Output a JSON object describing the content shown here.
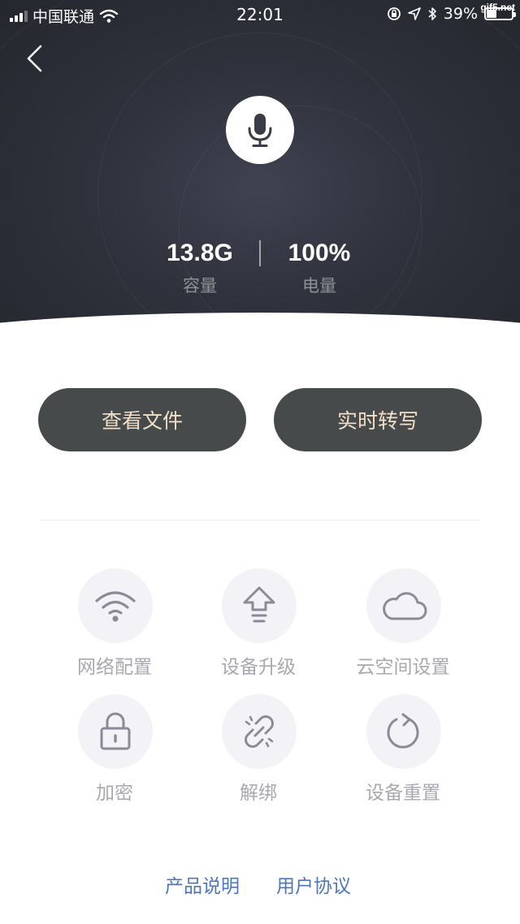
{
  "status_bar": {
    "carrier": "中国联通",
    "time": "22:01",
    "battery_percent": "39%",
    "battery_level": 0.39,
    "watermark": "gif5.net",
    "icons": [
      "signal-icon",
      "wifi-icon",
      "rotation-lock-icon",
      "location-icon",
      "bluetooth-icon",
      "battery-icon"
    ]
  },
  "header": {
    "back_icon": "chevron-left-icon",
    "device_icon": "microphone-icon",
    "capacity_value": "13.8G",
    "capacity_label": "容量",
    "battery_value": "100%",
    "battery_label": "电量"
  },
  "actions": {
    "view_files": "查看文件",
    "realtime_transcribe": "实时转写"
  },
  "grid": [
    {
      "label": "网络配置",
      "icon": "wifi-icon"
    },
    {
      "label": "设备升级",
      "icon": "upgrade-arrow-icon"
    },
    {
      "label": "云空间设置",
      "icon": "cloud-icon"
    },
    {
      "label": "加密",
      "icon": "lock-icon"
    },
    {
      "label": "解绑",
      "icon": "unlink-icon"
    },
    {
      "label": "设备重置",
      "icon": "reset-icon"
    }
  ],
  "footer": {
    "product_info": "产品说明",
    "user_agreement": "用户协议"
  },
  "colors": {
    "header_dark": "#2f323c",
    "button_bg": "#474a4b",
    "button_text": "#f3dfc8",
    "icon_circle": "#f3f3f7",
    "icon_stroke": "#8a8b96",
    "grid_label": "#a7a8b2",
    "link": "#4c76c2"
  }
}
